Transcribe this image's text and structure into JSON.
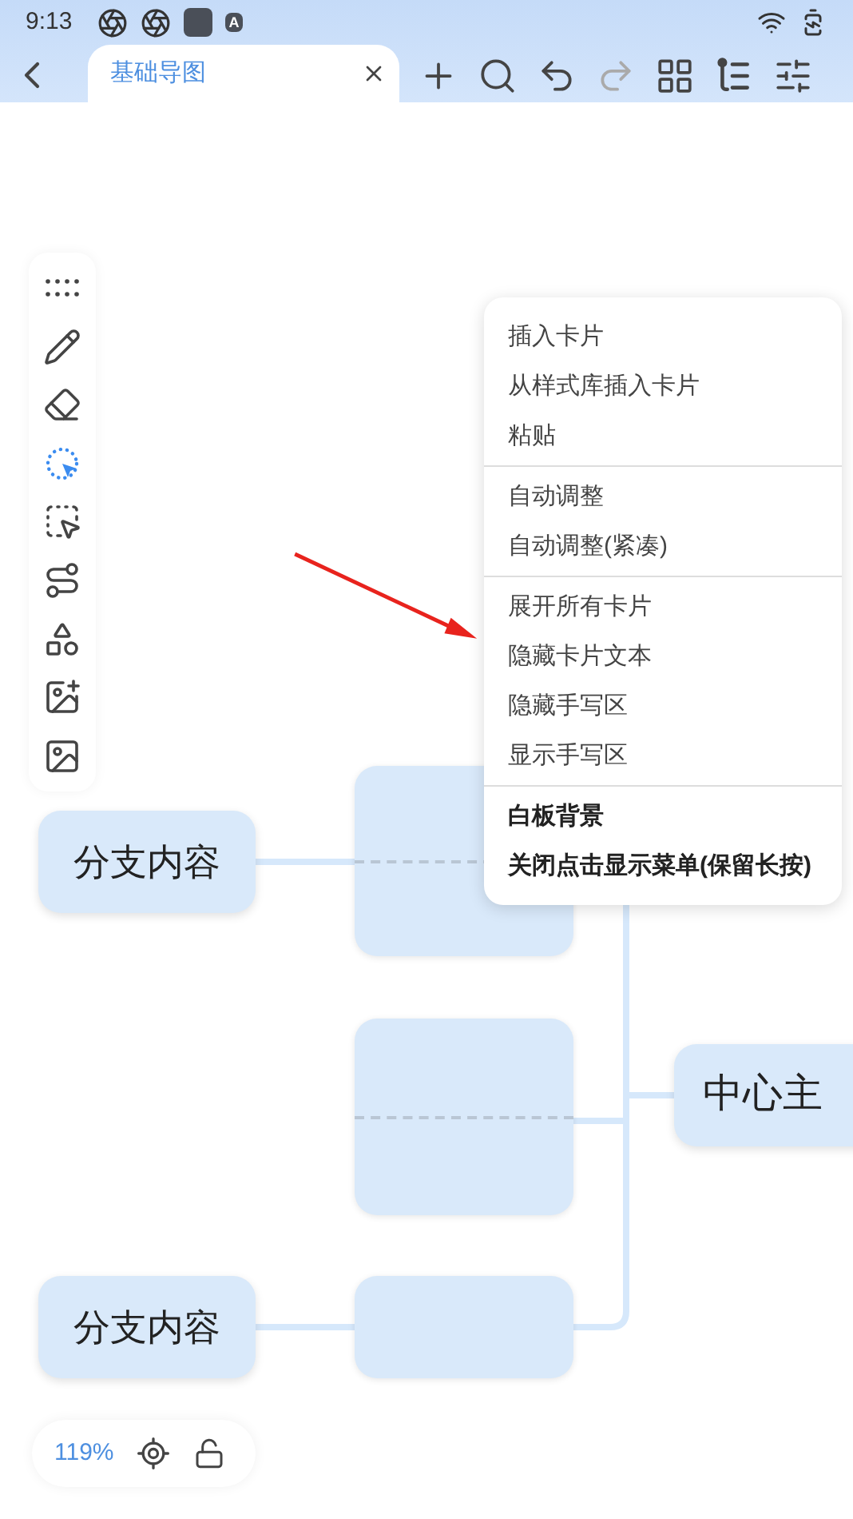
{
  "status_bar": {
    "time": "9:13",
    "badge": "A"
  },
  "tab": {
    "title": "基础导图",
    "selected": true
  },
  "toolbar": [
    {
      "disabled": false
    },
    {
      "disabled": false
    },
    {
      "disabled": false
    },
    {
      "disabled": true
    },
    {
      "disabled": false
    },
    {
      "disabled": false
    },
    {
      "disabled": false
    }
  ],
  "tools": [
    {
      "selected": false
    },
    {
      "selected": false
    },
    {
      "selected": false
    },
    {
      "selected": true
    },
    {
      "selected": false
    },
    {
      "selected": false
    },
    {
      "selected": false
    },
    {
      "selected": false
    },
    {
      "selected": false
    }
  ],
  "context_menu": [
    {
      "emphasized": false,
      "items": [
        "插入卡片",
        "从样式库插入卡片",
        "粘贴"
      ]
    },
    {
      "emphasized": false,
      "items": [
        "自动调整",
        "自动调整(紧凑)"
      ]
    },
    {
      "emphasized": false,
      "items": [
        "展开所有卡片",
        "隐藏卡片文本",
        "隐藏手写区",
        "显示手写区"
      ]
    },
    {
      "emphasized": true,
      "items": [
        "白板背景",
        "关闭点击显示菜单(保留长按)"
      ]
    }
  ],
  "mind_map": {
    "central_topic": "中心主",
    "branches": [
      "分支内容",
      "分支内容"
    ]
  },
  "zoom": {
    "level_text": "119%"
  }
}
